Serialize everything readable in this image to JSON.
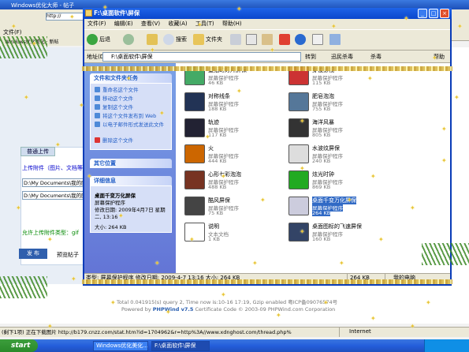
{
  "background_browser": {
    "title": "Windows优化大师 - 帖子",
    "address_stub": "http://",
    "file_menu": "文件(F)",
    "favorites_stub": "Windows优化美化 · 新帖",
    "upload_tab": "普通上传",
    "upload_label": "上传附件（图片、文档等）",
    "path1": "D:\\My Documents\\我的图片",
    "path2": "D:\\My Documents\\我的图片",
    "allow_types": "允许上传附件类型：gif",
    "publish_button": "发 布",
    "preview_button": "预览帖子",
    "footer_stat": "Total 0.041915(s) query 2, Time now is:10-16 17:19, Gzip enabled 粤ICP备09076574号",
    "footer_powered_prefix": "Powered by ",
    "footer_powered_brand": "PHPWind v7.5",
    "footer_powered_suffix": " Certificate  Code © 2003-09 PHPWind.com Corporation",
    "ie_status": "(剩下1项) 正在下载图片 http://b179.cnzz.com/stat.htm?id=1704962&r=http%3A//www.xdnghost.com/thread.php%",
    "ie_zone": "Internet"
  },
  "explorer": {
    "title": "F:\\桌面软件\\屏保",
    "controls": {
      "minimize": "_",
      "maximize": "□",
      "close": "×"
    },
    "menu": [
      "文件(F)",
      "编辑(E)",
      "查看(V)",
      "收藏(A)",
      "工具(T)",
      "帮助(H)"
    ],
    "toolbar": {
      "back": "后退",
      "search": "搜索",
      "folders": "文件夹"
    },
    "address_label": "地址(D)",
    "address_value": "F:\\桌面软件\\屏保",
    "go_label": "转到",
    "extra1": "迅民杀毒",
    "extra2": "杀毒",
    "extra3": "帮助",
    "task_pane": {
      "file_tasks_title": "文件和文件夹任务",
      "file_tasks": [
        "重命名这个文件",
        "移动这个文件",
        "复制这个文件",
        "将这个文件发布到 Web",
        "以电子邮件形式发送此文件",
        "删除这个文件"
      ],
      "other_places_title": "其它位置",
      "details_title": "详细信息",
      "details": {
        "name": "桌面千变万化屏保",
        "type": "屏幕保护程序",
        "modified": "修改日期: 2009年4月7日 星期二, 13:16",
        "size": "大小: 264 KB"
      }
    },
    "files": [
      {
        "name": "壁纸幻灯片屏保",
        "type": "屏幕保护程序",
        "size": "46 KB",
        "icon": "monitor-icon",
        "color": "#4a6"
      },
      {
        "name": "穿梭影视",
        "type": "屏幕保护程序",
        "size": "115 KB",
        "icon": "monitor-icon",
        "color": "#c33"
      },
      {
        "name": "对称线条",
        "type": "屏幕保护程序",
        "size": "188 KB",
        "icon": "lines-icon",
        "color": "#235"
      },
      {
        "name": "肥皂泡泡",
        "type": "屏幕保护程序",
        "size": "755 KB",
        "icon": "monitor-icon",
        "color": "#579"
      },
      {
        "name": "轨迹",
        "type": "屏幕保护程序",
        "size": "117 KB",
        "icon": "trail-icon",
        "color": "#223"
      },
      {
        "name": "海洋风暴",
        "type": "屏幕保护程序",
        "size": "805 KB",
        "icon": "ocean-icon",
        "color": "#333"
      },
      {
        "name": "火",
        "type": "屏幕保护程序",
        "size": "444 KB",
        "icon": "fire-icon",
        "color": "#c60"
      },
      {
        "name": "水波纹屏保",
        "type": "屏幕保护程序",
        "size": "240 KB",
        "icon": "nipple-icon",
        "color": "#ddd"
      },
      {
        "name": "心形七彩泡泡",
        "type": "屏幕保护程序",
        "size": "488 KB",
        "icon": "heart-icon",
        "color": "#732"
      },
      {
        "name": "炫光时钟",
        "type": "屏幕保护程序",
        "size": "869 KB",
        "icon": "clock-icon",
        "color": "#2a2"
      },
      {
        "name": "酷风屏保",
        "type": "屏幕保护程序",
        "size": "75 KB",
        "icon": "wind-icon",
        "color": "#444"
      },
      {
        "name": "桌面千变万化屏保",
        "type": "屏幕保护程序",
        "size": "264 KB",
        "icon": "star-icon",
        "color": "#ccd",
        "selected": true
      },
      {
        "name": "说明",
        "type": "文本文档",
        "size": "1 KB",
        "icon": "text-doc-icon",
        "color": "#fff"
      },
      {
        "name": "桌面图标的飞速屏保",
        "type": "屏幕保护程序",
        "size": "160 KB",
        "icon": "icons-icon",
        "color": "#346"
      }
    ],
    "status_left": "类型: 屏幕保护程序 修改日期: 2009-4-7 13:16 大小: 264 KB",
    "status_size": "264 KB",
    "status_location": "我的电脑"
  },
  "taskbar": {
    "start": "start",
    "buttons": [
      "Windows优化美化...",
      "F:\\桌面软件\\屏保"
    ]
  }
}
